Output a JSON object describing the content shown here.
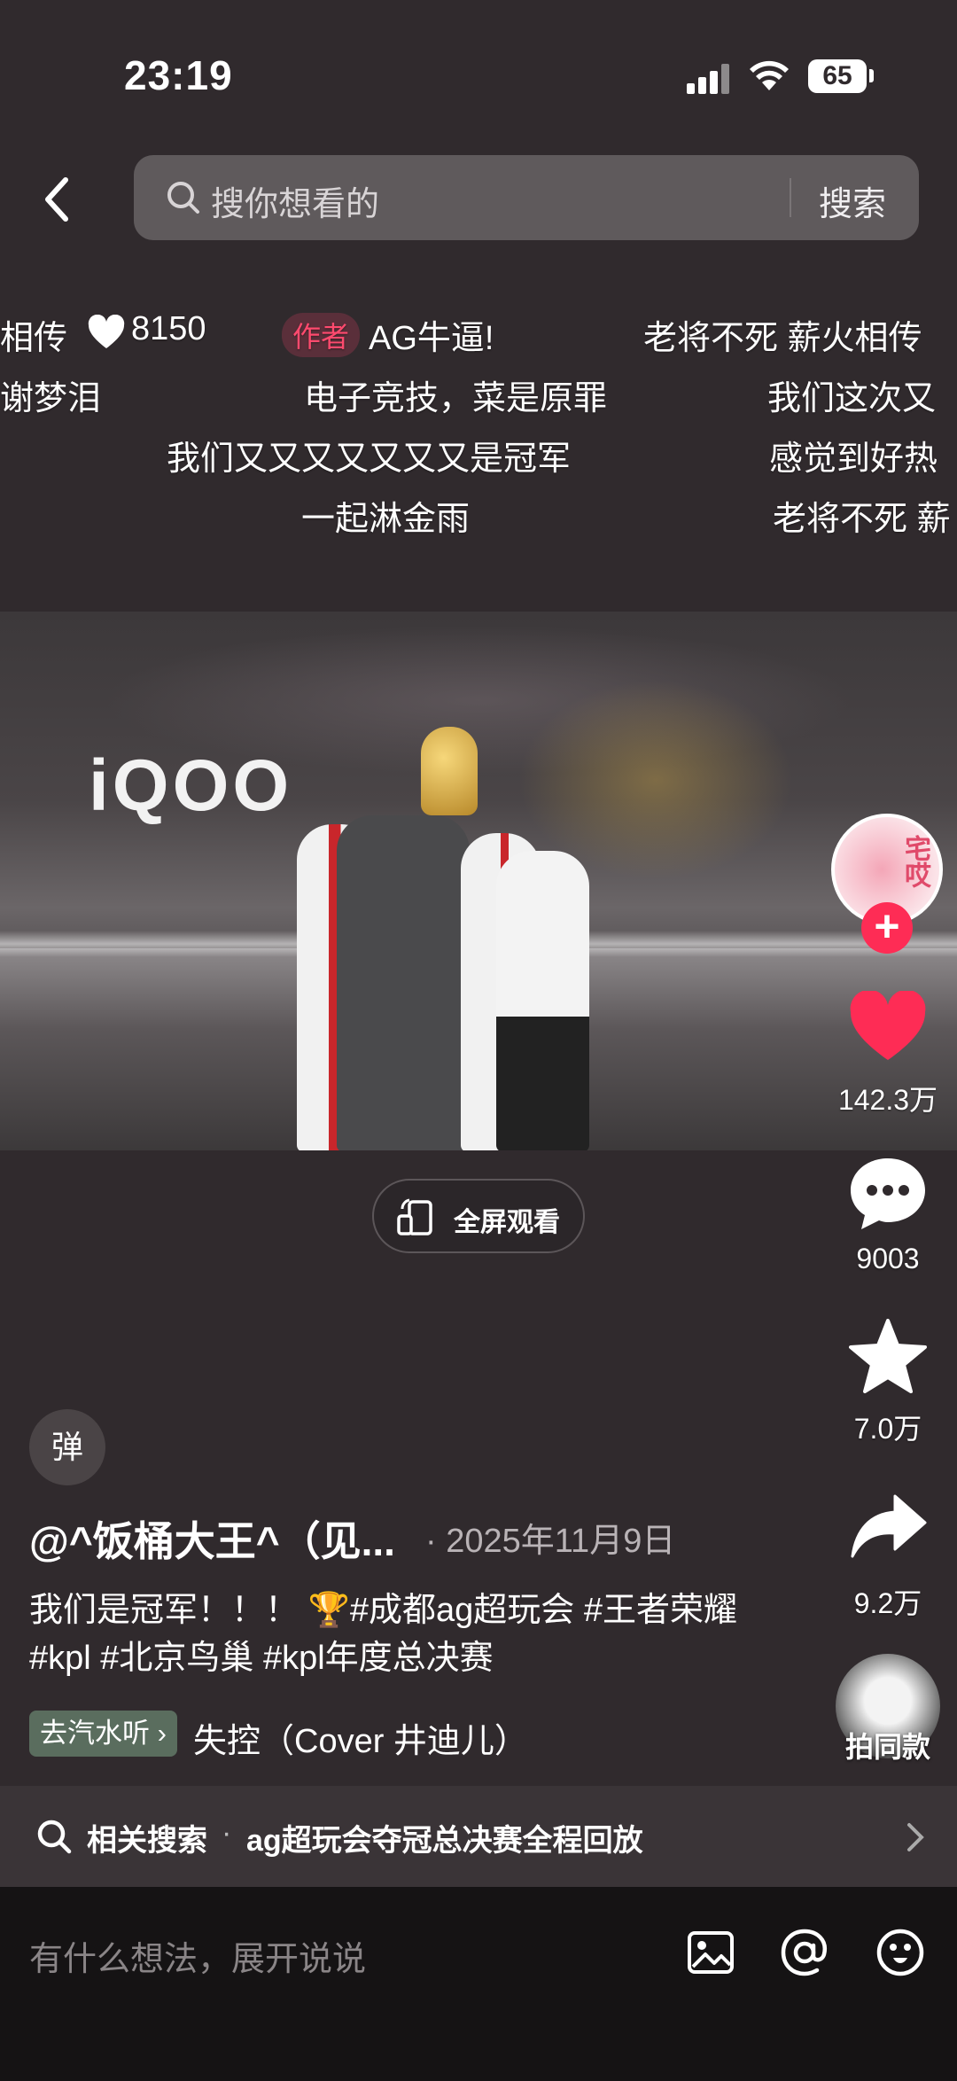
{
  "status_bar": {
    "time": "23:19",
    "battery": "65"
  },
  "search": {
    "placeholder": "搜你想看的",
    "button": "搜索"
  },
  "danmaku": [
    "相传",
    "8150",
    "作者",
    "AG牛逼!",
    "老将不死 薪火相传",
    "谢梦泪",
    "电子竞技，菜是原罪",
    "我们这次又",
    "我们又又又又又又又是冠军",
    "感觉到好热",
    "一起淋金雨",
    "老将不死 薪"
  ],
  "video": {
    "banner_text": "iQOO",
    "fullscreen_label": "全屏观看"
  },
  "actions": {
    "like_count": "142.3万",
    "comment_count": "9003",
    "favorite_count": "7.0万",
    "share_count": "9.2万",
    "same_style_label": "拍同款",
    "avatar_text": "宅哎"
  },
  "danmaku_toggle": "弹",
  "post": {
    "author": "@^饭桶大王^（见...",
    "date": "· 2025年11月9日",
    "caption": "我们是冠军！！！ 🏆#成都ag超玩会 #王者荣耀 #kpl #北京鸟巢 #kpl年度总决赛",
    "music_tag": "去汽水听 ›",
    "music_title": "失控（Cover 井迪儿）"
  },
  "related_search": {
    "label": "相关搜索",
    "separator": "·",
    "query": "ag超玩会夺冠总决赛全程回放"
  },
  "comment_bar": {
    "placeholder": "有什么想法，展开说说"
  },
  "colors": {
    "background": "#302a2d",
    "accent": "#fe2c55",
    "search_box": "#5f5a5c"
  }
}
